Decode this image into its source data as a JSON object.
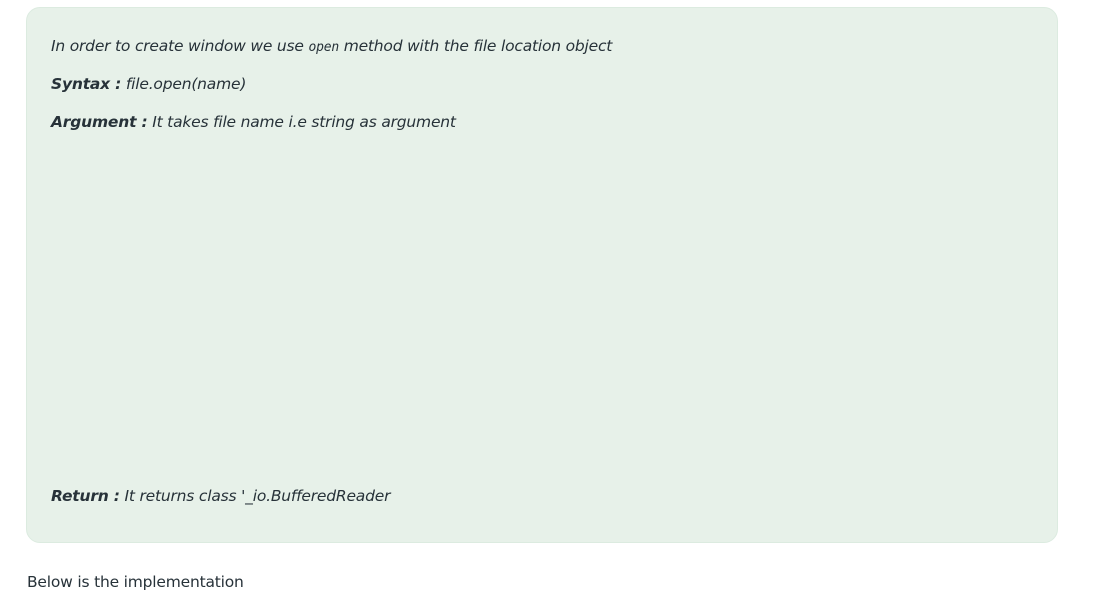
{
  "note": {
    "intro": {
      "before": "In order to create window we use ",
      "code": "open",
      "after": " method with the file location object"
    },
    "syntax": {
      "label": "Syntax :",
      "value": " file.open(name)"
    },
    "argument": {
      "label": "Argument :",
      "value": " It takes file name i.e string as argument"
    },
    "return": {
      "label": "Return :",
      "value": " It returns class '_io.BufferedReader"
    }
  },
  "body": {
    "below_text": "Below is the implementation"
  },
  "colors": {
    "card_background": "#e7f1e9",
    "text": "#273239"
  }
}
